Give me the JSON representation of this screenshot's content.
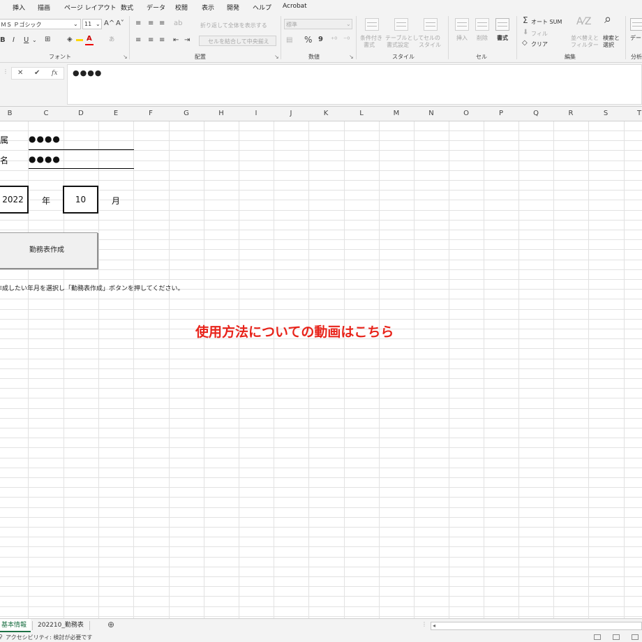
{
  "menu": [
    "挿入",
    "描画",
    "ページ レイアウト",
    "数式",
    "データ",
    "校閲",
    "表示",
    "開発",
    "ヘルプ",
    "Acrobat"
  ],
  "ribbon": {
    "font_name": "ＭＳ Ｐゴシック",
    "font_size": "11",
    "grow_font": "A^",
    "shrink_font": "A˅",
    "bold": "B",
    "italic": "I",
    "underline": "U",
    "wrap_text": "折り返して全体を表示する",
    "merge_center": "セルを結合して中央揃え",
    "number_format": "標準",
    "percent": "%",
    "comma": "9",
    "autosum": "オート SUM",
    "fill": "フィル",
    "clear": "クリア",
    "conditional_format": [
      "条件付き",
      "書式"
    ],
    "table_format": [
      "テーブルとして",
      "書式設定"
    ],
    "cell_style": [
      "セルの",
      "スタイル"
    ],
    "insert": "挿入",
    "delete": "削除",
    "format": "書式",
    "sort_filter": [
      "並べ替えと",
      "フィルター"
    ],
    "find_select": [
      "検索と",
      "選択"
    ],
    "analyze": [
      "デー",
      "分析"
    ],
    "groups": {
      "font": "フォント",
      "alignment": "配置",
      "number": "数値",
      "style": "スタイル",
      "cells": "セル",
      "editing": "編集",
      "analysis": "分析"
    }
  },
  "formula_bar": {
    "cancel": "✕",
    "enter": "✔",
    "fx": "fx",
    "content": "●●●●"
  },
  "columns": [
    "B",
    "C",
    "D",
    "E",
    "F",
    "G",
    "H",
    "I",
    "J",
    "K",
    "L",
    "M",
    "N",
    "O",
    "P",
    "Q",
    "R",
    "S",
    "T"
  ],
  "sheet": {
    "affiliation_label": "所属",
    "affiliation_value": "●●●●",
    "name_label": "氏名",
    "name_value": "●●●●",
    "year_value": "2022",
    "year_unit": "年",
    "month_value": "10",
    "month_unit": "月",
    "create_button": "勤務表作成",
    "instruction": "作成したい年月を選択し「勤務表作成」ボタンを押してください。",
    "video_link": "使用方法についての動画はこちら",
    "link_color": "#e8231a"
  },
  "tabs": {
    "active": "基本情報",
    "second": "202210_勤務表",
    "add": "⊕"
  },
  "status": {
    "accessibility": "アクセシビリティ: 検討が必要です"
  }
}
